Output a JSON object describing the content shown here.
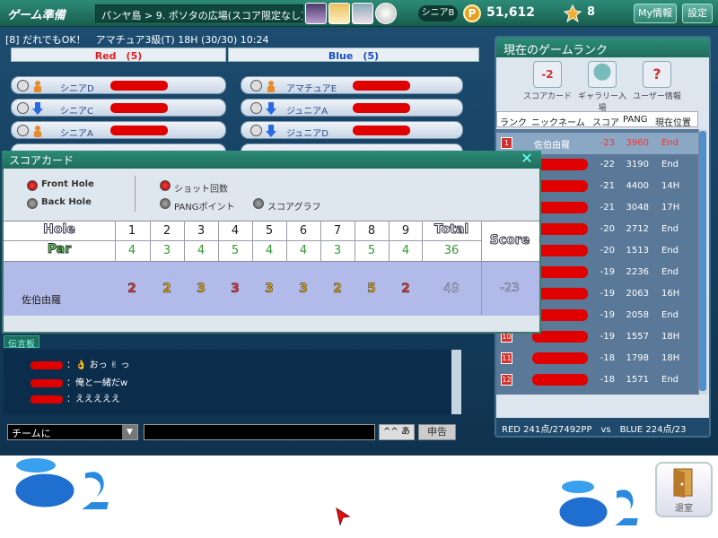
{
  "topbar": {
    "title": "ゲーム準備",
    "breadcrumb": "パンヤ島 > 9. ポソタの広場(スコア限定なし)",
    "rank": "シニアB",
    "pang_icon": "P",
    "pang": "51,612",
    "cookie": "8",
    "myinfo_btn": "My情報",
    "settings_btn": "設定"
  },
  "room": {
    "info": "[8] だれでもOK！　アマチュア3級(T) 18H (30/30) 10:24",
    "red_label": "Red",
    "red_count": "(5)",
    "blue_label": "Blue",
    "blue_count": "(5)"
  },
  "red_players": [
    {
      "rank": "シニアD"
    },
    {
      "rank": "シニアC"
    },
    {
      "rank": "シニアA"
    }
  ],
  "blue_players": [
    {
      "rank": "アマチュアE"
    },
    {
      "rank": "ジュニアA"
    },
    {
      "rank": "ジュニアD"
    }
  ],
  "rank_panel": {
    "title": "現在のゲームランク",
    "tab_scorecard": "スコアカード",
    "tab_gallery": "ギャラリー入場",
    "tab_userinfo": "ユーザー情報",
    "tab_badge": "-2",
    "headers": {
      "rank": "ランク",
      "nickname": "ニックネーム",
      "score": "スコア",
      "pang": "PANG",
      "position": "現在位置"
    },
    "rows": [
      {
        "no": "1",
        "name": "佐伯由羅",
        "score": "-23",
        "pang": "3960",
        "pos": "End"
      },
      {
        "no": "2",
        "score": "-22",
        "pang": "3190",
        "pos": "End"
      },
      {
        "no": "3",
        "score": "-21",
        "pang": "4400",
        "pos": "14H"
      },
      {
        "no": "4",
        "score": "-21",
        "pang": "3048",
        "pos": "17H"
      },
      {
        "no": "5",
        "score": "-20",
        "pang": "2712",
        "pos": "End"
      },
      {
        "no": "6",
        "score": "-20",
        "pang": "1513",
        "pos": "End"
      },
      {
        "no": "7",
        "score": "-19",
        "pang": "2236",
        "pos": "End"
      },
      {
        "no": "8",
        "score": "-19",
        "pang": "2063",
        "pos": "16H"
      },
      {
        "no": "9",
        "score": "-19",
        "pang": "2058",
        "pos": "End"
      },
      {
        "no": "10",
        "score": "-19",
        "pang": "1557",
        "pos": "18H"
      },
      {
        "no": "11",
        "score": "-18",
        "pang": "1798",
        "pos": "18H"
      },
      {
        "no": "12",
        "score": "-18",
        "pang": "1571",
        "pos": "End"
      }
    ],
    "footer": "RED 241点/27492PP　vs　BLUE 224点/23"
  },
  "chat": {
    "board_label": "伝言板",
    "messages": [
      {
        "text": "：👌 おっ ✌ っ"
      },
      {
        "text": "：俺と一緒だw"
      },
      {
        "text": "：えええええ"
      }
    ],
    "channel": "チームに",
    "ime_label": "^^ あ",
    "report_btn": "申告"
  },
  "scorecard": {
    "title": "スコアカード",
    "close": "✕",
    "opt_front": "Front Hole",
    "opt_back": "Back Hole",
    "opt_shots": "ショット回数",
    "opt_pang": "PANGポイント",
    "opt_graph": "スコアグラフ",
    "hole_label": "Hole",
    "par_label": "Par",
    "total_label": "Total",
    "score_label": "Score",
    "holes": [
      "1",
      "2",
      "3",
      "4",
      "5",
      "6",
      "7",
      "8",
      "9"
    ],
    "pars": [
      "4",
      "3",
      "4",
      "5",
      "4",
      "4",
      "3",
      "5",
      "4"
    ],
    "par_total": "36",
    "player": {
      "name": "佐伯由羅",
      "strokes": [
        "2",
        "2",
        "3",
        "3",
        "3",
        "3",
        "2",
        "5",
        "2"
      ],
      "total": "49",
      "score": "-23"
    }
  },
  "bottom": {
    "exit_label": "退室"
  },
  "colors": {
    "teal": "#2d8b78",
    "red": "#e10000",
    "blue": "#1a4fc4"
  }
}
